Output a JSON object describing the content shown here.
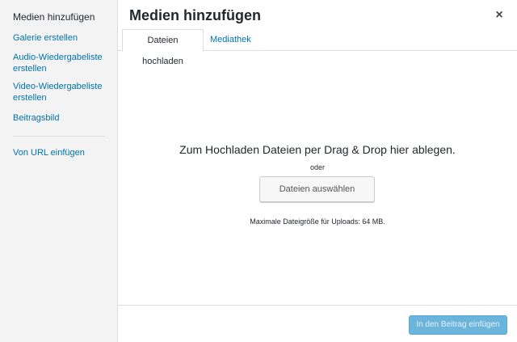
{
  "sidebar": {
    "title": "Medien hinzufügen",
    "items": [
      {
        "label": "Galerie erstellen"
      },
      {
        "label": "Audio-Wiedergabeliste erstellen"
      },
      {
        "label": "Video-Wiedergabeliste erstellen"
      },
      {
        "label": "Beitragsbild"
      },
      {
        "label": "Von URL einfügen"
      }
    ]
  },
  "header": {
    "title": "Medien hinzufügen",
    "close_symbol": "×"
  },
  "tabs": [
    {
      "label": "Dateien hochladen",
      "active": true
    },
    {
      "label": "Mediathek",
      "active": false
    }
  ],
  "upload": {
    "drop_text": "Zum Hochladen Dateien per Drag & Drop hier ablegen.",
    "or_text": "oder",
    "select_button": "Dateien auswählen",
    "max_size": "Maximale Dateigröße für Uploads: 64 MB."
  },
  "footer": {
    "insert_button": "In den Beitrag einfügen"
  },
  "colors": {
    "link": "#0073aa",
    "primary_disabled": "#6bb5dc",
    "sidebar_bg": "#f3f3f3"
  }
}
